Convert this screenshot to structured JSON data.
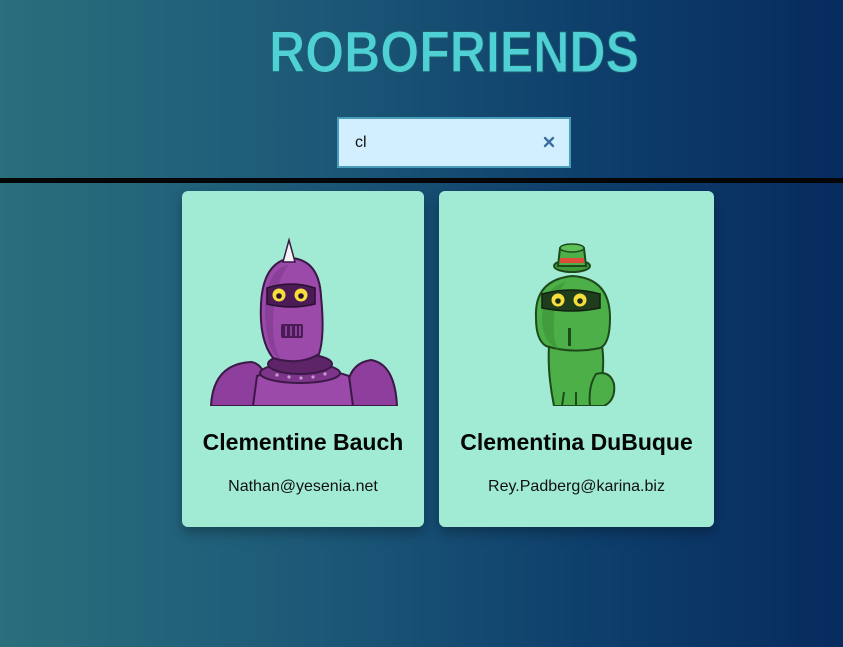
{
  "app": {
    "title": "ROBOFRIENDS",
    "title_color": "#4fd0d4"
  },
  "search": {
    "value": "cl",
    "clear_icon": "close-icon"
  },
  "robots": [
    {
      "name": "Clementine Bauch",
      "email": "Nathan@yesenia.net",
      "avatar_color": "#9a4ea8"
    },
    {
      "name": "Clementina DuBuque",
      "email": "Rey.Padberg@karina.biz",
      "avatar_color": "#4daf47"
    }
  ],
  "colors": {
    "card_bg": "#a1ead4",
    "search_bg": "#d2efff"
  }
}
